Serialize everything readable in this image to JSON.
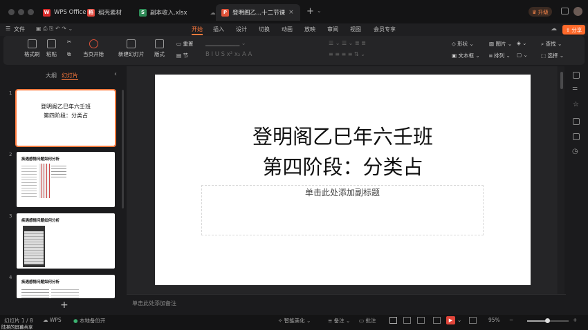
{
  "tabs": [
    {
      "label": "WPS Office",
      "icon": "wps-logo-icon"
    },
    {
      "label": "稻壳素材",
      "icon": "docer-icon"
    },
    {
      "label": "副本收入.xlsx",
      "icon": "spreadsheet-icon"
    },
    {
      "label": "登明阁乙...十二节课",
      "icon": "presentation-icon"
    }
  ],
  "upgrade_label": "升级",
  "share_label": "分享",
  "file_menu": "文件",
  "menu": [
    "开始",
    "插入",
    "设计",
    "切换",
    "动画",
    "放映",
    "审阅",
    "视图",
    "会员专享"
  ],
  "ribbon": {
    "format_painter": "格式刷",
    "paste": "粘贴",
    "start_from_current": "当页开始",
    "new_slide": "新建幻灯片",
    "layout": "版式",
    "reset": "重置",
    "section": "节",
    "shape": "形状",
    "textbox": "文本框",
    "picture": "图片",
    "arrange": "排列",
    "find": "查找",
    "select": "选择"
  },
  "sidebar": {
    "outline_tab": "大纲",
    "slides_tab": "幻灯片",
    "thumbs": [
      {
        "num": "1",
        "line1": "登明阁乙巳年六壬班",
        "line2": "第四阶段：分类占"
      },
      {
        "num": "2",
        "title": "疾遇感情问题如何分析"
      },
      {
        "num": "3",
        "title": "疾遇感情问题如何分析"
      },
      {
        "num": "4",
        "title": "疾遇感情问题如何分析"
      }
    ]
  },
  "slide": {
    "title_line1": "登明阁乙巳年六壬班",
    "title_line2": "第四阶段：分类占",
    "subtitle_placeholder": "单击此处添加副标题"
  },
  "notes_placeholder": "单击此处添加备注",
  "status": {
    "slide_counter": "幻灯片 1 / 8",
    "wps": "WPS",
    "backup": "本地备份开",
    "beautify": "智能美化",
    "notes": "备注",
    "comments": "批注",
    "zoom": "95%",
    "screen_share": "陆某的屏幕共享"
  },
  "colors": {
    "accent": "#ff7a3d"
  }
}
